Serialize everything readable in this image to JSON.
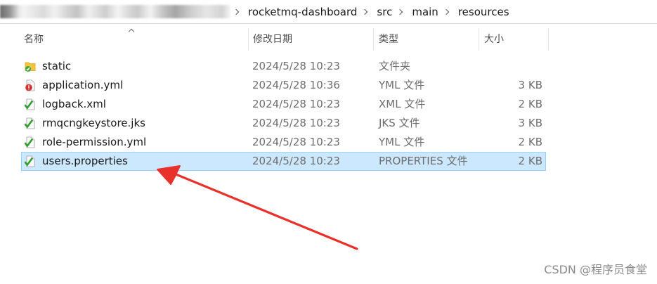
{
  "breadcrumb": {
    "blurred_prefix": "",
    "items": [
      {
        "label": "rocketmq-dashboard"
      },
      {
        "label": "src"
      },
      {
        "label": "main"
      },
      {
        "label": "resources"
      }
    ]
  },
  "columns": {
    "name": "名称",
    "date": "修改日期",
    "type": "类型",
    "size": "大小"
  },
  "files": [
    {
      "name": "static",
      "date": "2024/5/28 10:23",
      "type": "文件夹",
      "size": "",
      "icon": "folder-sync-icon",
      "selected": false
    },
    {
      "name": "application.yml",
      "date": "2024/5/28 10:36",
      "type": "YML 文件",
      "size": "3 KB",
      "icon": "file-conflict-icon",
      "selected": false
    },
    {
      "name": "logback.xml",
      "date": "2024/5/28 10:23",
      "type": "XML 文件",
      "size": "2 KB",
      "icon": "file-synced-icon",
      "selected": false
    },
    {
      "name": "rmqcngkeystore.jks",
      "date": "2024/5/28 10:23",
      "type": "JKS 文件",
      "size": "3 KB",
      "icon": "file-synced-icon",
      "selected": false
    },
    {
      "name": "role-permission.yml",
      "date": "2024/5/28 10:23",
      "type": "YML 文件",
      "size": "2 KB",
      "icon": "file-synced-icon",
      "selected": false
    },
    {
      "name": "users.properties",
      "date": "2024/5/28 10:23",
      "type": "PROPERTIES 文件",
      "size": "2 KB",
      "icon": "file-synced-icon",
      "selected": true
    }
  ],
  "annotation": {
    "color": "#e8312a",
    "points_to": "users.properties"
  },
  "watermark": "CSDN @程序员食堂"
}
